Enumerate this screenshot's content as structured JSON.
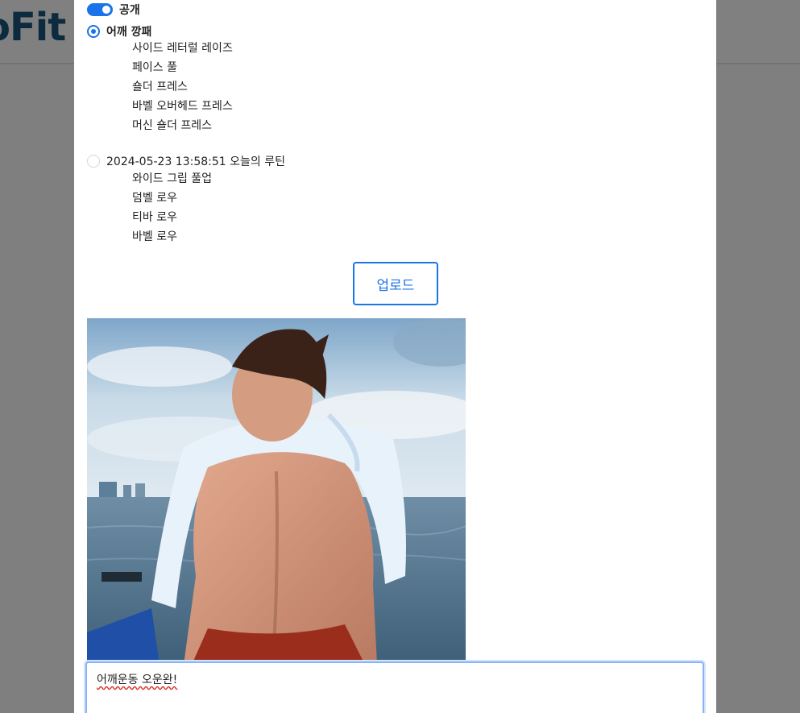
{
  "background": {
    "logo_text": "oFit"
  },
  "visibility": {
    "label": "공개",
    "enabled": true
  },
  "routines": [
    {
      "title": "어깨 깡패",
      "selected": true,
      "exercises": [
        "사이드 레터럴 레이즈",
        "페이스 풀",
        "숄더 프레스",
        "바벨 오버헤드 프레스",
        "머신 숄더 프레스"
      ]
    },
    {
      "title": "2024-05-23 13:58:51 오늘의 루틴",
      "selected": false,
      "exercises": [
        "와이드 그립 풀업",
        "덤벨 로우",
        "티바 로우",
        "바벨 로우"
      ]
    }
  ],
  "upload_button": "업로드",
  "caption": {
    "value": "어깨운동 오운완!"
  },
  "colors": {
    "accent": "#1a73e8",
    "overlay": "#7f7f7f"
  },
  "icons": {
    "toggle": "toggle-on-icon",
    "radio_checked": "radio-checked-icon",
    "radio_unchecked": "radio-unchecked-icon"
  }
}
